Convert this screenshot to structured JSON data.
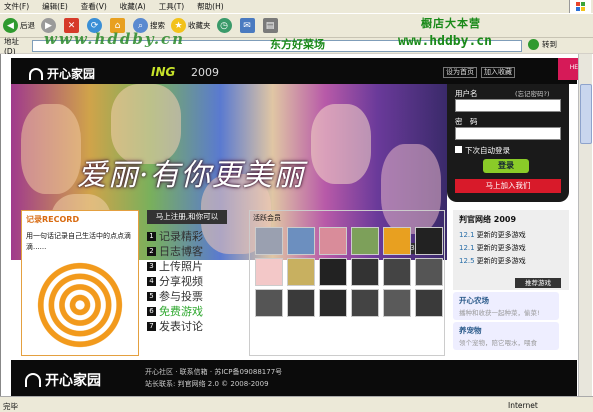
{
  "menu": [
    "文件(F)",
    "编辑(E)",
    "查看(V)",
    "收藏(A)",
    "工具(T)",
    "帮助(H)"
  ],
  "toolbar": {
    "back": "后退",
    "search": "搜索",
    "favorites": "收藏夹"
  },
  "promo": {
    "top_right": "橱店大本营",
    "mid": "东方好菜场",
    "url": "www.hddby.cn",
    "watermark": "www.hddby.cn"
  },
  "address": {
    "label": "地址(D)",
    "go": "转到"
  },
  "header": {
    "logo": "开心家园",
    "ing": "ING",
    "year": "2009",
    "set_home": "设为首页",
    "add_fav": "加入收藏",
    "help": "HELP"
  },
  "banner": {
    "title": "爱丽·有你更美丽",
    "pages": [
      "1",
      "2",
      "3",
      "4",
      "5"
    ],
    "active_page": "1"
  },
  "login": {
    "username_label": "用户名",
    "forgot": "(忘记密码?)",
    "password_label": "密　码",
    "remember": "下次自动登录",
    "login_btn": "登录",
    "join_btn": "马上加入我们"
  },
  "record": {
    "title": "记录RECORD",
    "text": "用一句话记录自己生活中的点点滴滴......"
  },
  "join": {
    "tag": "马上注册,和你可以",
    "features": [
      {
        "n": "1",
        "text": "记录精彩",
        "green": false
      },
      {
        "n": "2",
        "text": "日志博客",
        "green": false
      },
      {
        "n": "3",
        "text": "上传照片",
        "green": false
      },
      {
        "n": "4",
        "text": "分享视频",
        "green": false
      },
      {
        "n": "5",
        "text": "参与投票",
        "green": false
      },
      {
        "n": "6",
        "text": "免费游戏",
        "green": true
      },
      {
        "n": "7",
        "text": "发表讨论",
        "green": false
      }
    ]
  },
  "members": {
    "title": "活跃会员",
    "avatars": [
      "#9aa0b0",
      "#6c8fbf",
      "#d98c9a",
      "#7da05a",
      "#e8a020",
      "#222222",
      "#f3c8c8",
      "#c8b060",
      "#222222",
      "#333333",
      "#444444",
      "#555555",
      "#555555",
      "#3a3a3a",
      "#2a2a2a",
      "#444444",
      "#5a5a5a",
      "#3a3a3a"
    ]
  },
  "news": {
    "title": "判官网络 2009",
    "items": [
      {
        "date": "12.1",
        "text": "更新的更多游戏"
      },
      {
        "date": "12.1",
        "text": "更新的更多游戏"
      },
      {
        "date": "12.5",
        "text": "更新的更多游戏"
      }
    ],
    "more": "推荐游戏"
  },
  "farms": [
    {
      "title": "开心农场",
      "desc": "播种和收获一起种菜，偷菜!"
    },
    {
      "title": "养宠物",
      "desc": "领个宠物，陪它喂水，喂食"
    }
  ],
  "footer": {
    "logo": "开心家园",
    "line1": "开心社区 · 联系信箱 · 苏ICP备09088177号",
    "line2": "站长联系: 判官网络 2.0 © 2008-2009"
  },
  "status": {
    "left": "完毕",
    "right": "Internet"
  }
}
